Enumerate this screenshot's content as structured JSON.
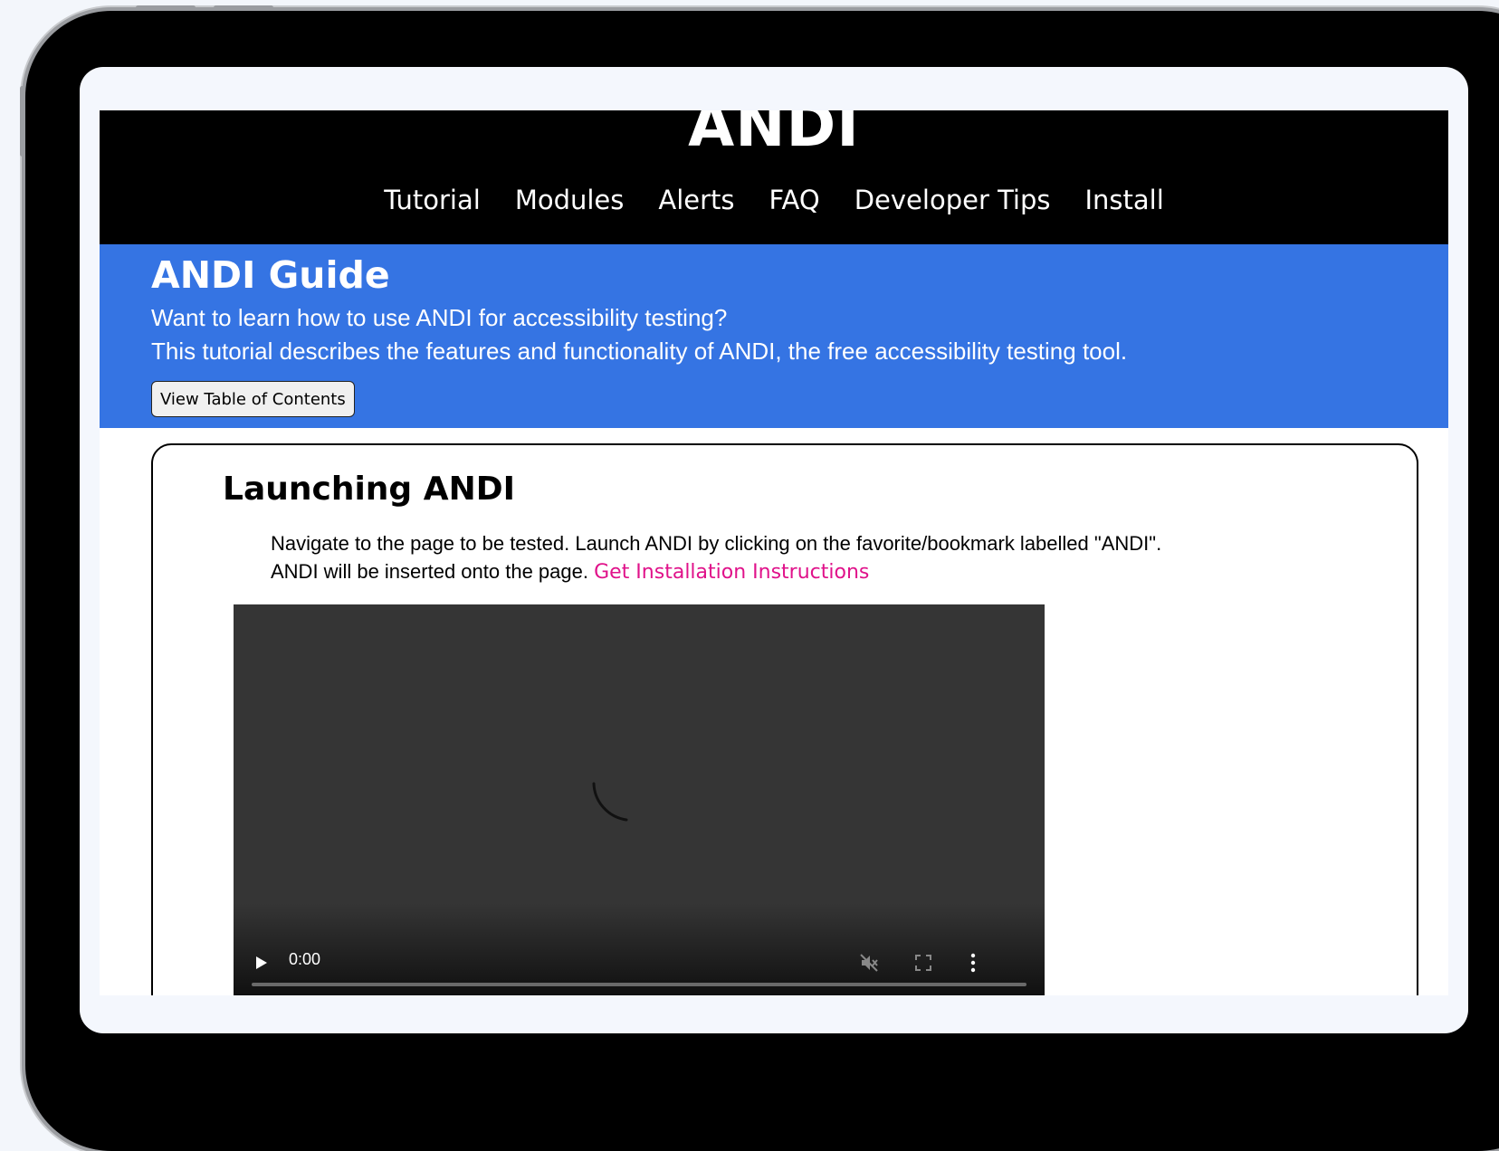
{
  "site": {
    "logo": "ANDI",
    "nav": [
      "Tutorial",
      "Modules",
      "Alerts",
      "FAQ",
      "Developer Tips",
      "Install"
    ]
  },
  "hero": {
    "title": "ANDI Guide",
    "line1": "Want to learn how to use ANDI for accessibility testing?",
    "line2": "This tutorial describes the features and functionality of ANDI, the free accessibility testing tool.",
    "toc_button": "View Table of Contents"
  },
  "section": {
    "title": "Launching ANDI",
    "para1": "Navigate to the page to be tested. Launch ANDI by clicking on the favorite/bookmark labelled \"ANDI\".",
    "para2": "ANDI will be inserted onto the page.",
    "link": "Get Installation Instructions"
  },
  "video": {
    "time": "0:00",
    "progress": 0,
    "icons": [
      "play-icon",
      "muted-icon",
      "fullscreen-icon",
      "more-options-icon"
    ],
    "state": "loading"
  },
  "colors": {
    "header_bg": "#000000",
    "hero_bg": "#3574e3",
    "link": "#e0128a",
    "video_bg": "#353535"
  }
}
